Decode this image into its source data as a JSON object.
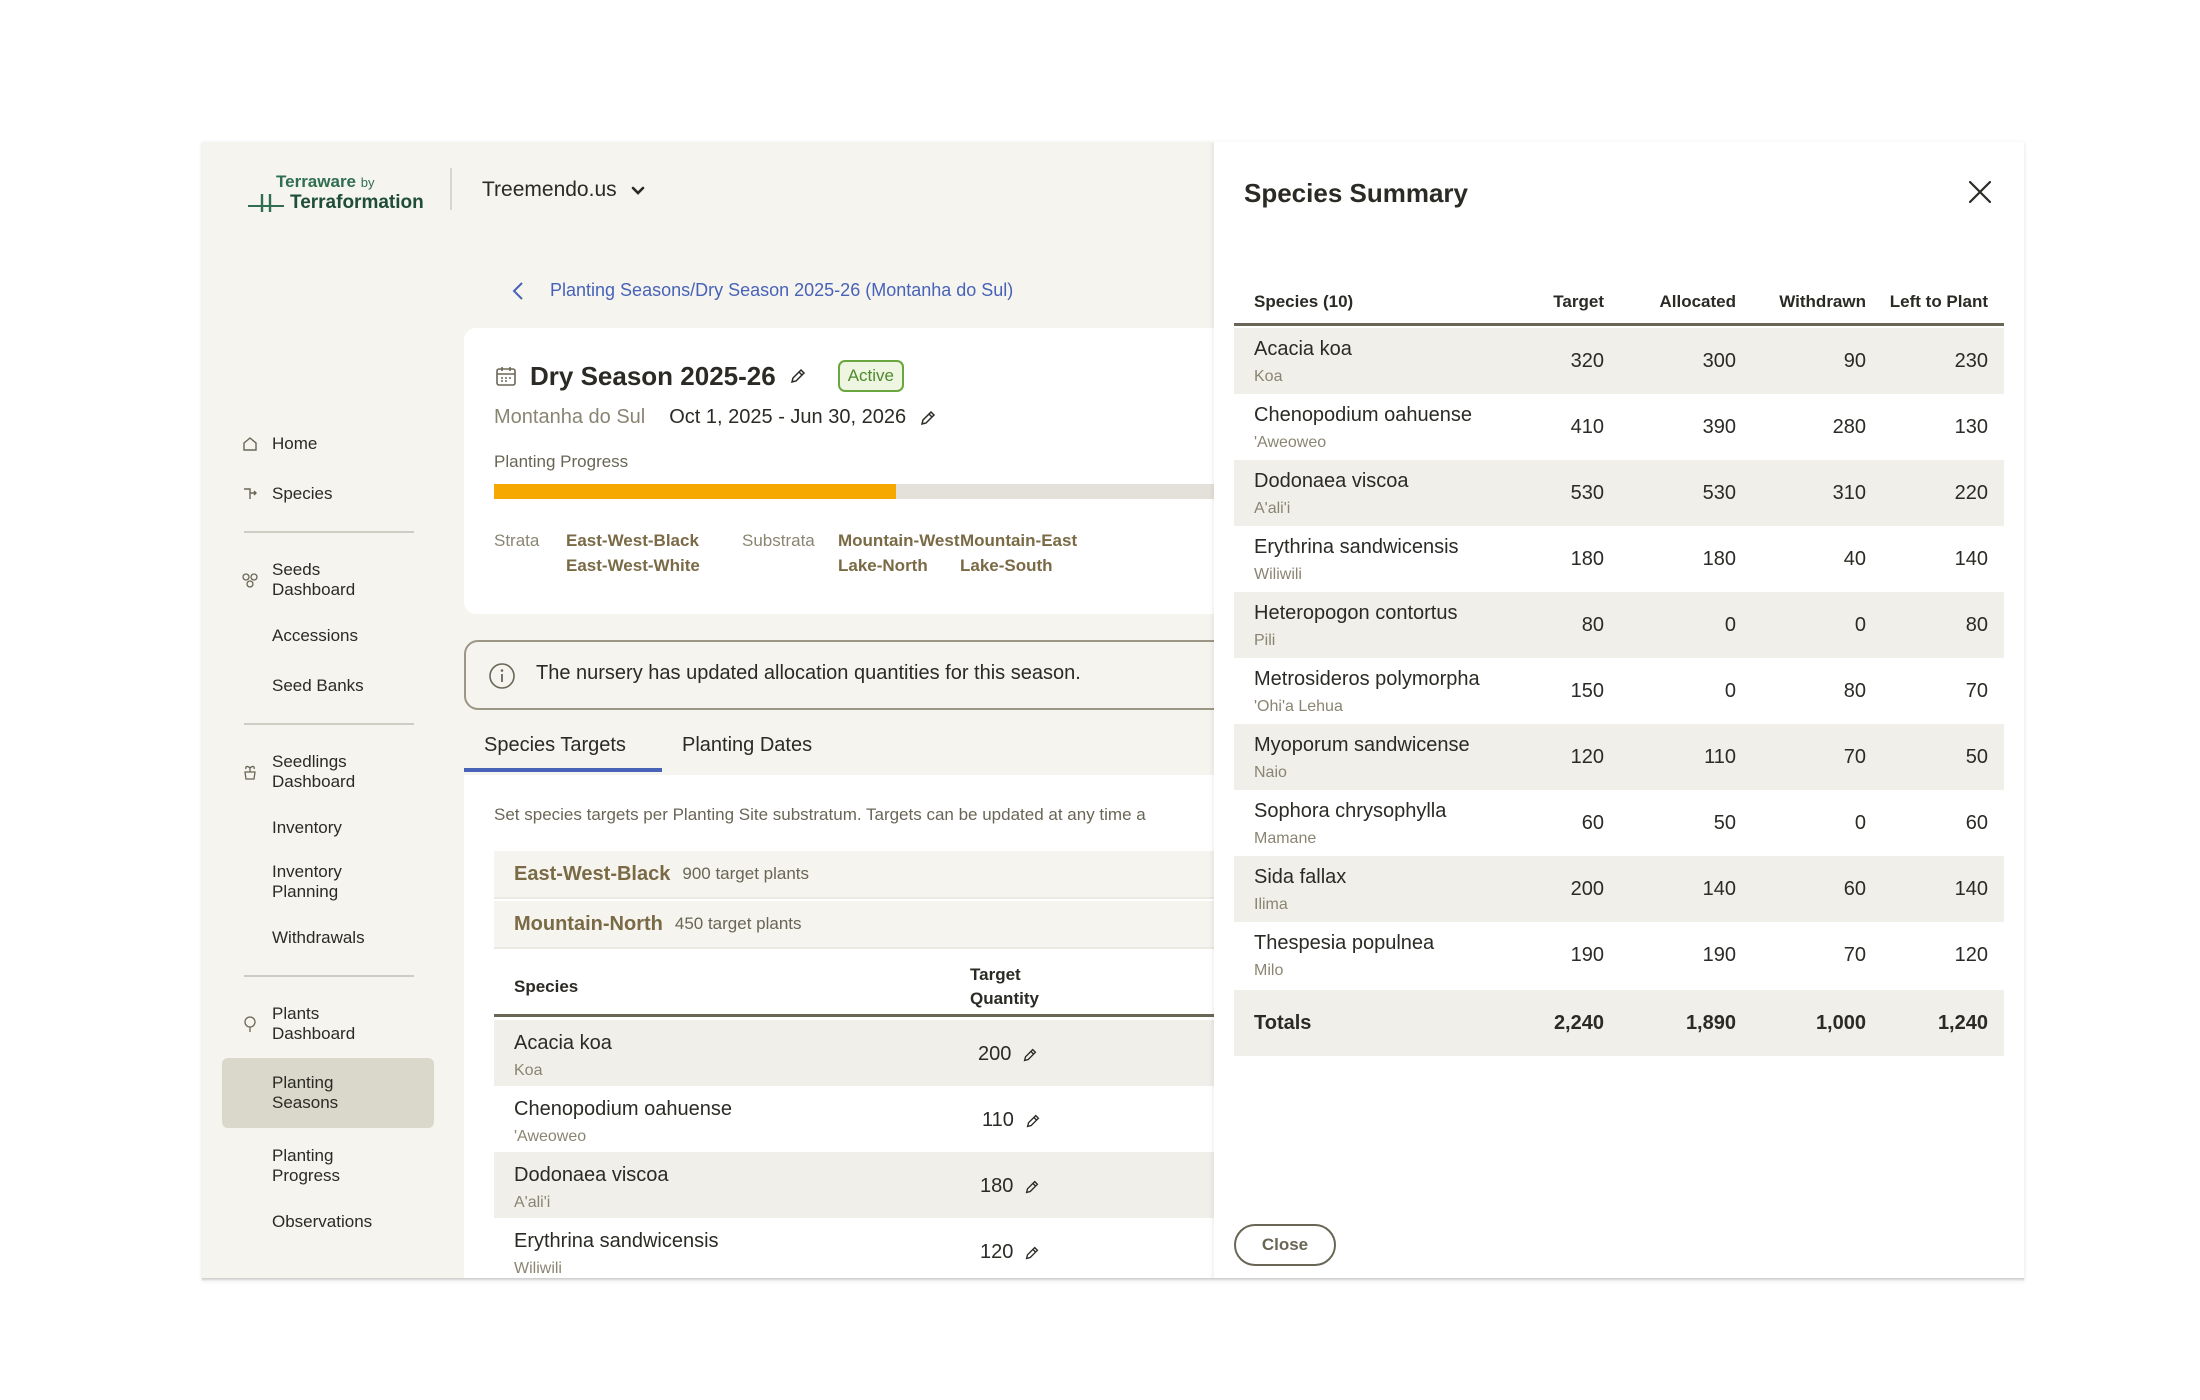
{
  "brand": {
    "line1": "Terraware",
    "by": "by",
    "line2": "Terraformation"
  },
  "org": {
    "name": "Treemendo.us"
  },
  "sidebar": {
    "home": "Home",
    "species": "Species",
    "seeds_dashboard": "Seeds Dashboard",
    "accessions": "Accessions",
    "seed_banks": "Seed Banks",
    "seedlings_dashboard": "Seedlings Dashboard",
    "inventory": "Inventory",
    "inventory_planning": "Inventory Planning",
    "withdrawals": "Withdrawals",
    "plants_dashboard": "Plants Dashboard",
    "planting_seasons": "Planting Seasons",
    "planting_progress": "Planting Progress",
    "observations": "Observations"
  },
  "breadcrumb": {
    "text": "Planting Seasons/Dry Season 2025-26 (Montanha do Sul)"
  },
  "season": {
    "title": "Dry Season 2025-26",
    "status": "Active",
    "site": "Montanha do Sul",
    "dates": "Oct 1, 2025 - Jun 30, 2026",
    "progress_label": "Planting Progress",
    "progress_fraction": 0.55,
    "strata_label": "Strata",
    "strata": [
      "East-West-Black",
      "East-West-White"
    ],
    "substrata_label": "Substrata",
    "substrata": [
      "Mountain-West",
      "Mountain-East",
      "Lake-North",
      "Lake-South"
    ]
  },
  "banner": {
    "text": "The nursery has updated allocation quantities for this season."
  },
  "tabs": {
    "species_targets": "Species Targets",
    "planting_dates": "Planting Dates"
  },
  "targets": {
    "description": "Set species targets per Planting Site substratum. Targets can be updated at any time a",
    "groups": [
      {
        "name": "East-West-Black",
        "target": "900 target plants"
      },
      {
        "name": "Mountain-North",
        "target": "450 target plants"
      }
    ],
    "col_species": "Species",
    "col_target": "Target",
    "col_quantity": "Quantity",
    "rows": [
      {
        "scientific": "Acacia koa",
        "common": "Koa",
        "qty": "200"
      },
      {
        "scientific": "Chenopodium oahuense",
        "common": "'Aweoweo",
        "qty": "110"
      },
      {
        "scientific": "Dodonaea viscoa",
        "common": "A'ali'i",
        "qty": "180"
      },
      {
        "scientific": "Erythrina sandwicensis",
        "common": "Wiliwili",
        "qty": "120"
      }
    ]
  },
  "summary": {
    "title": "Species Summary",
    "columns": [
      "Species (10)",
      "Target",
      "Allocated",
      "Withdrawn",
      "Left to Plant"
    ],
    "rows": [
      {
        "scientific": "Acacia koa",
        "common": "Koa",
        "target": "320",
        "allocated": "300",
        "withdrawn": "90",
        "left": "230"
      },
      {
        "scientific": "Chenopodium oahuense",
        "common": "'Aweoweo",
        "target": "410",
        "allocated": "390",
        "withdrawn": "280",
        "left": "130"
      },
      {
        "scientific": "Dodonaea viscoa",
        "common": "A'ali'i",
        "target": "530",
        "allocated": "530",
        "withdrawn": "310",
        "left": "220"
      },
      {
        "scientific": "Erythrina sandwicensis",
        "common": "Wiliwili",
        "target": "180",
        "allocated": "180",
        "withdrawn": "40",
        "left": "140"
      },
      {
        "scientific": "Heteropogon contortus",
        "common": "Pili",
        "target": "80",
        "allocated": "0",
        "withdrawn": "0",
        "left": "80"
      },
      {
        "scientific": "Metrosideros polymorpha",
        "common": "'Ohi'a Lehua",
        "target": "150",
        "allocated": "0",
        "withdrawn": "80",
        "left": "70"
      },
      {
        "scientific": "Myoporum sandwicense",
        "common": "Naio",
        "target": "120",
        "allocated": "110",
        "withdrawn": "70",
        "left": "50"
      },
      {
        "scientific": "Sophora chrysophylla",
        "common": "Mamane",
        "target": "60",
        "allocated": "50",
        "withdrawn": "0",
        "left": "60"
      },
      {
        "scientific": "Sida fallax",
        "common": "Ilima",
        "target": "200",
        "allocated": "140",
        "withdrawn": "60",
        "left": "140"
      },
      {
        "scientific": "Thespesia populnea",
        "common": "Milo",
        "target": "190",
        "allocated": "190",
        "withdrawn": "70",
        "left": "120"
      }
    ],
    "totals": {
      "label": "Totals",
      "target": "2,240",
      "allocated": "1,890",
      "withdrawn": "1,000",
      "left": "1,240"
    },
    "close_label": "Close"
  },
  "colors": {
    "accent": "#4862b8",
    "progress": "#f7a800",
    "active_badge": "#6aa63f",
    "brand_green": "#2f6e4f"
  }
}
